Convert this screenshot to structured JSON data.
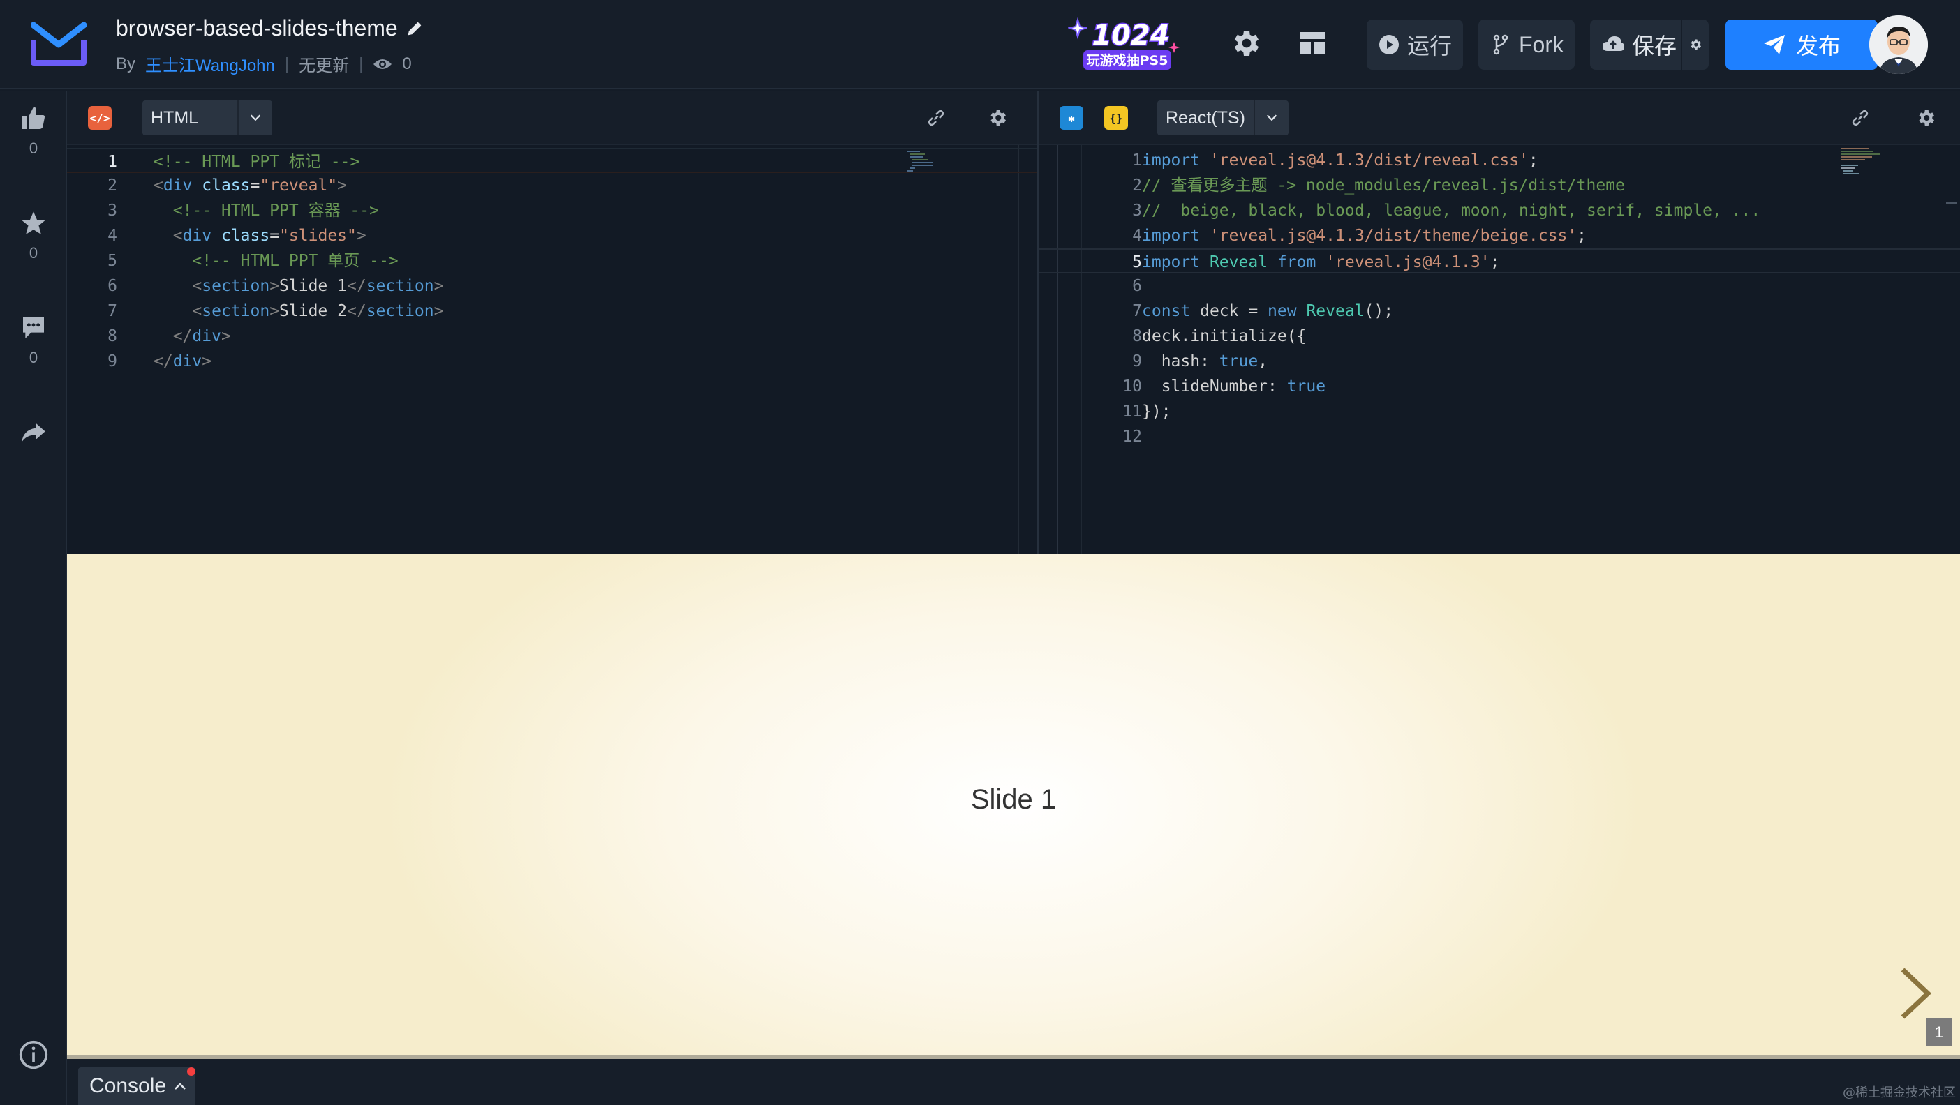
{
  "header": {
    "project_title": "browser-based-slides-theme",
    "by_label": "By",
    "author": "王士江WangJohn",
    "update_status": "无更新",
    "view_count": "0",
    "promo_text": "1024",
    "promo_subtext": "玩游戏抽PS5",
    "run_label": "运行",
    "fork_label": "Fork",
    "save_label": "保存",
    "publish_label": "发布",
    "colors": {
      "publish_bg": "#1e80ff",
      "author_link": "#2f8fff",
      "header_bg": "#161e29"
    }
  },
  "rail": {
    "like_count": "0",
    "star_count": "0",
    "comment_count": "0"
  },
  "left_pane": {
    "language": "HTML",
    "badge_text": "</>",
    "badge_color": "#e8623d",
    "active_line": 1,
    "lines": [
      {
        "n": "1",
        "parts": [
          {
            "c": "t-cm",
            "t": "<!-- HTML PPT 标记 -->"
          }
        ]
      },
      {
        "n": "2",
        "parts": [
          {
            "c": "t-pun",
            "t": "<"
          },
          {
            "c": "t-tag",
            "t": "div"
          },
          {
            "c": "t-txt",
            "t": " "
          },
          {
            "c": "t-attr",
            "t": "class"
          },
          {
            "c": "t-txt",
            "t": "="
          },
          {
            "c": "t-str",
            "t": "\"reveal\""
          },
          {
            "c": "t-pun",
            "t": ">"
          }
        ]
      },
      {
        "n": "3",
        "parts": [
          {
            "c": "t-txt",
            "t": "  "
          },
          {
            "c": "t-cm",
            "t": "<!-- HTML PPT 容器 -->"
          }
        ]
      },
      {
        "n": "4",
        "parts": [
          {
            "c": "t-txt",
            "t": "  "
          },
          {
            "c": "t-pun",
            "t": "<"
          },
          {
            "c": "t-tag",
            "t": "div"
          },
          {
            "c": "t-txt",
            "t": " "
          },
          {
            "c": "t-attr",
            "t": "class"
          },
          {
            "c": "t-txt",
            "t": "="
          },
          {
            "c": "t-str",
            "t": "\"slides\""
          },
          {
            "c": "t-pun",
            "t": ">"
          }
        ]
      },
      {
        "n": "5",
        "parts": [
          {
            "c": "t-txt",
            "t": "    "
          },
          {
            "c": "t-cm",
            "t": "<!-- HTML PPT 单页 -->"
          }
        ]
      },
      {
        "n": "6",
        "parts": [
          {
            "c": "t-txt",
            "t": "    "
          },
          {
            "c": "t-pun",
            "t": "<"
          },
          {
            "c": "t-tag",
            "t": "section"
          },
          {
            "c": "t-pun",
            "t": ">"
          },
          {
            "c": "t-txt",
            "t": "Slide 1"
          },
          {
            "c": "t-pun",
            "t": "</"
          },
          {
            "c": "t-tag",
            "t": "section"
          },
          {
            "c": "t-pun",
            "t": ">"
          }
        ]
      },
      {
        "n": "7",
        "parts": [
          {
            "c": "t-txt",
            "t": "    "
          },
          {
            "c": "t-pun",
            "t": "<"
          },
          {
            "c": "t-tag",
            "t": "section"
          },
          {
            "c": "t-pun",
            "t": ">"
          },
          {
            "c": "t-txt",
            "t": "Slide 2"
          },
          {
            "c": "t-pun",
            "t": "</"
          },
          {
            "c": "t-tag",
            "t": "section"
          },
          {
            "c": "t-pun",
            "t": ">"
          }
        ]
      },
      {
        "n": "8",
        "parts": [
          {
            "c": "t-txt",
            "t": "  "
          },
          {
            "c": "t-pun",
            "t": "</"
          },
          {
            "c": "t-tag",
            "t": "div"
          },
          {
            "c": "t-pun",
            "t": ">"
          }
        ]
      },
      {
        "n": "9",
        "parts": [
          {
            "c": "t-pun",
            "t": "</"
          },
          {
            "c": "t-tag",
            "t": "div"
          },
          {
            "c": "t-pun",
            "t": ">"
          }
        ]
      }
    ]
  },
  "right_pane": {
    "language": "React(TS)",
    "badge_text": "{}",
    "badge_color": "#f3c623",
    "active_line": 5,
    "lines": [
      {
        "n": "1",
        "parts": [
          {
            "c": "t-kw",
            "t": "import"
          },
          {
            "c": "t-txt",
            "t": " "
          },
          {
            "c": "t-str",
            "t": "'reveal.js@4.1.3/dist/reveal.css'"
          },
          {
            "c": "t-txt",
            "t": ";"
          }
        ]
      },
      {
        "n": "2",
        "parts": [
          {
            "c": "t-cm",
            "t": "// 查看更多主题 -> node_modules/reveal.js/dist/theme"
          }
        ]
      },
      {
        "n": "3",
        "parts": [
          {
            "c": "t-cm",
            "t": "//  beige, black, blood, league, moon, night, serif, simple, ..."
          }
        ]
      },
      {
        "n": "4",
        "parts": [
          {
            "c": "t-kw",
            "t": "import"
          },
          {
            "c": "t-txt",
            "t": " "
          },
          {
            "c": "t-str",
            "t": "'reveal.js@4.1.3/dist/theme/beige.css'"
          },
          {
            "c": "t-txt",
            "t": ";"
          }
        ]
      },
      {
        "n": "5",
        "parts": [
          {
            "c": "t-kw",
            "t": "import"
          },
          {
            "c": "t-txt",
            "t": " "
          },
          {
            "c": "t-cls",
            "t": "Reveal"
          },
          {
            "c": "t-txt",
            "t": " "
          },
          {
            "c": "t-kw",
            "t": "from"
          },
          {
            "c": "t-txt",
            "t": " "
          },
          {
            "c": "t-str",
            "t": "'reveal.js@4.1.3'"
          },
          {
            "c": "t-txt",
            "t": ";"
          }
        ]
      },
      {
        "n": "6",
        "parts": []
      },
      {
        "n": "7",
        "parts": [
          {
            "c": "t-kw",
            "t": "const"
          },
          {
            "c": "t-txt",
            "t": " deck = "
          },
          {
            "c": "t-kw",
            "t": "new"
          },
          {
            "c": "t-txt",
            "t": " "
          },
          {
            "c": "t-cls",
            "t": "Reveal"
          },
          {
            "c": "t-txt",
            "t": "();"
          }
        ]
      },
      {
        "n": "8",
        "parts": [
          {
            "c": "t-txt",
            "t": "deck.initialize({"
          }
        ]
      },
      {
        "n": "9",
        "parts": [
          {
            "c": "t-txt",
            "t": "  hash: "
          },
          {
            "c": "t-kw",
            "t": "true"
          },
          {
            "c": "t-txt",
            "t": ","
          }
        ]
      },
      {
        "n": "10",
        "parts": [
          {
            "c": "t-txt",
            "t": "  slideNumber: "
          },
          {
            "c": "t-kw",
            "t": "true"
          }
        ]
      },
      {
        "n": "11",
        "parts": [
          {
            "c": "t-txt",
            "t": "});"
          }
        ]
      },
      {
        "n": "12",
        "parts": []
      }
    ]
  },
  "preview": {
    "slide_text": "Slide 1",
    "slide_number": "1"
  },
  "console": {
    "label": "Console"
  },
  "watermark": "@稀土掘金技术社区"
}
